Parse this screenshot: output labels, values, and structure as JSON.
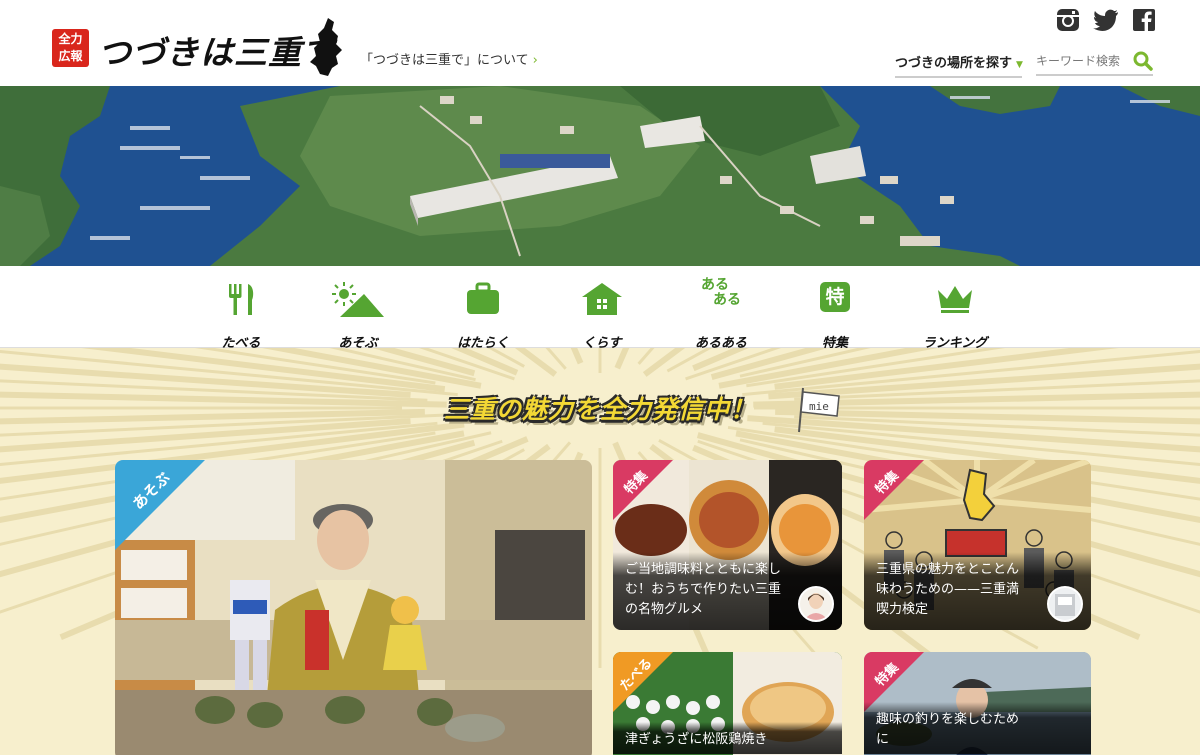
{
  "header": {
    "badge_line1": "全力",
    "badge_line2": "広報",
    "logo_text": "つづきは三重で",
    "about_link": "「つづきは三重で」について",
    "place_search_label": "つづきの場所を探す",
    "keyword_placeholder": "キーワード検索",
    "social": [
      "instagram-icon",
      "twitter-icon",
      "facebook-icon"
    ]
  },
  "nav": {
    "items": [
      {
        "label": "たべる",
        "icon": "fork-knife-icon"
      },
      {
        "label": "あそぶ",
        "icon": "sun-mountain-icon"
      },
      {
        "label": "はたらく",
        "icon": "briefcase-icon"
      },
      {
        "label": "くらす",
        "icon": "house-icon"
      },
      {
        "label": "あるある",
        "icon": "aruaru-icon"
      },
      {
        "label": "特集",
        "icon": "special-icon"
      },
      {
        "label": "ランキング",
        "icon": "crown-icon"
      }
    ],
    "aruaru_glyph": "ある",
    "special_glyph": "特"
  },
  "main": {
    "headline": "三重の魅力を全力発信中！",
    "flag_text": "mie",
    "cards": [
      {
        "tag": "あそぶ",
        "title": "",
        "tag_color": "#3aa6d8"
      },
      {
        "tag": "特集",
        "title": "ご当地調味料とともに楽しむ！おうちで作りたい三重の名物グルメ",
        "tag_color": "#d93a63"
      },
      {
        "tag": "特集",
        "title": "三重県の魅力をとことん味わうための——三重満喫力検定",
        "tag_color": "#d93a63"
      },
      {
        "tag": "たべる",
        "title": "津ぎょうざに松阪鶏焼き",
        "tag_color": "#f09a24"
      },
      {
        "tag": "特集",
        "title": "趣味の釣りを楽しむために",
        "tag_color": "#d93a63"
      }
    ]
  },
  "colors": {
    "accent_green": "#7cb82f",
    "brand_red": "#d9261c",
    "main_bg": "#f7efcd"
  }
}
